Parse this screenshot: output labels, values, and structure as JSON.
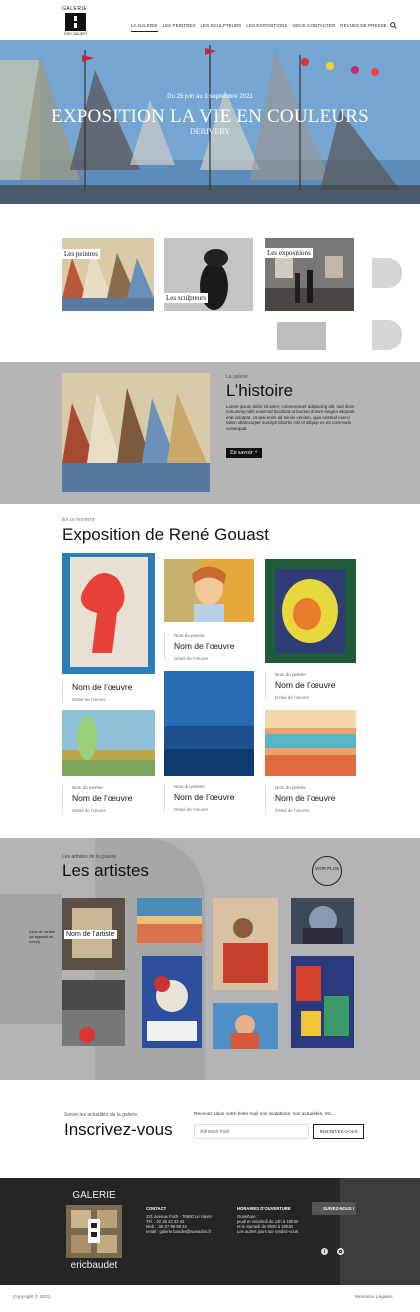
{
  "header": {
    "logo_top": "GALERIE",
    "logo_bottom": "ERIC BAUDET",
    "nav": [
      "LA GALERIE",
      "LES PEINTRES",
      "LES SCULPTEURS",
      "LES EXPOSITIONS",
      "NOUS CONTACTER",
      "REVUES DE PRESSE"
    ],
    "active_nav": "LA GALERIE",
    "search_icon": "search-icon"
  },
  "hero": {
    "date": "Du 25 juin au 3 septembre 2021",
    "title": "EXPOSITION LA VIE EN COULEURS",
    "subtitle": "DERIVERY"
  },
  "categories": {
    "peintres": "Les peintres",
    "sculpteurs": "Les sculpteurs",
    "expositions": "Les expositions"
  },
  "histoire": {
    "eyebrow": "La galerie",
    "title": "L’histoire",
    "body": "Lorem ipsum dolor sit amet, consectetuer adipiscing elit, sed diam nonummy nibh euismod tincidunt ut laoreet dolore magna aliquam erat volutpat. Ut wisi enim ad minim veniam, quis nostrud exerci tation ullamcorper suscipit lobortis nisl ut aliquip ex ea commodo consequat.",
    "button": "En savoir +"
  },
  "expo": {
    "eyebrow": "En ce moment",
    "title": "Exposition de René Gouast",
    "works": [
      {
        "painter": "",
        "name": "Nom de l’œuvre",
        "detail": "Détail de l’œuvre"
      },
      {
        "painter": "Nom du peintre",
        "name": "Nom de l’œuvre",
        "detail": "Détail de l’œuvre"
      },
      {
        "painter": "Nom du peintre",
        "name": "Nom de l’œuvre",
        "detail": "Détail de l’œuvre"
      },
      {
        "painter": "Nom du peintre",
        "name": "Nom de l’œuvre",
        "detail": "Détail de l’œuvre"
      },
      {
        "painter": "Nom du peintre",
        "name": "Nom de l’œuvre",
        "detail": "Détail de l’œuvre"
      },
      {
        "painter": "Nom du peintre",
        "name": "Nom de l’œuvre",
        "detail": "Détail de l’œuvre"
      }
    ]
  },
  "artistes": {
    "eyebrow": "Les artistes de la galerie",
    "title": "Les artistes",
    "voir_plus": "VOIR PLUS",
    "side_note": "(Nom de l’artiste qui apparaît au survol)",
    "hover_label": "Nom de l’artiste"
  },
  "newsletter": {
    "eyebrow": "Suivre les actualités de la galerie",
    "title": "Inscrivez-vous",
    "prompt": "Recevez dans votre boite mail nos invitations, nos actualités, etc...",
    "placeholder": "Adresse mail",
    "button": "INSCRIVEZ-VOUS"
  },
  "footer": {
    "logo_top": "GALERIE",
    "logo_bottom": "ericbaudet",
    "contact_title": "CONTACT",
    "contact_lines": [
      "121 avenue Foch - 76600 Le Havre",
      "Tél. : 02 35 42 32 44",
      "Mob. : 06 07 99 98 23",
      "email : galerie.baudet@wanadoo.fr"
    ],
    "hours_title": "HORAIRES D’OUVERTURE",
    "hours_lines": [
      "Ouverture :",
      "jeudi et vendredi de 14h à 19h30",
      "et le Samedi de 9h30 à 19h30",
      "Les autres jours sur rendez-vous"
    ],
    "social_title": "SUIVEZ-NOUS !",
    "copyright": "Copyright © 2021",
    "legal": "Mentions Légales"
  }
}
